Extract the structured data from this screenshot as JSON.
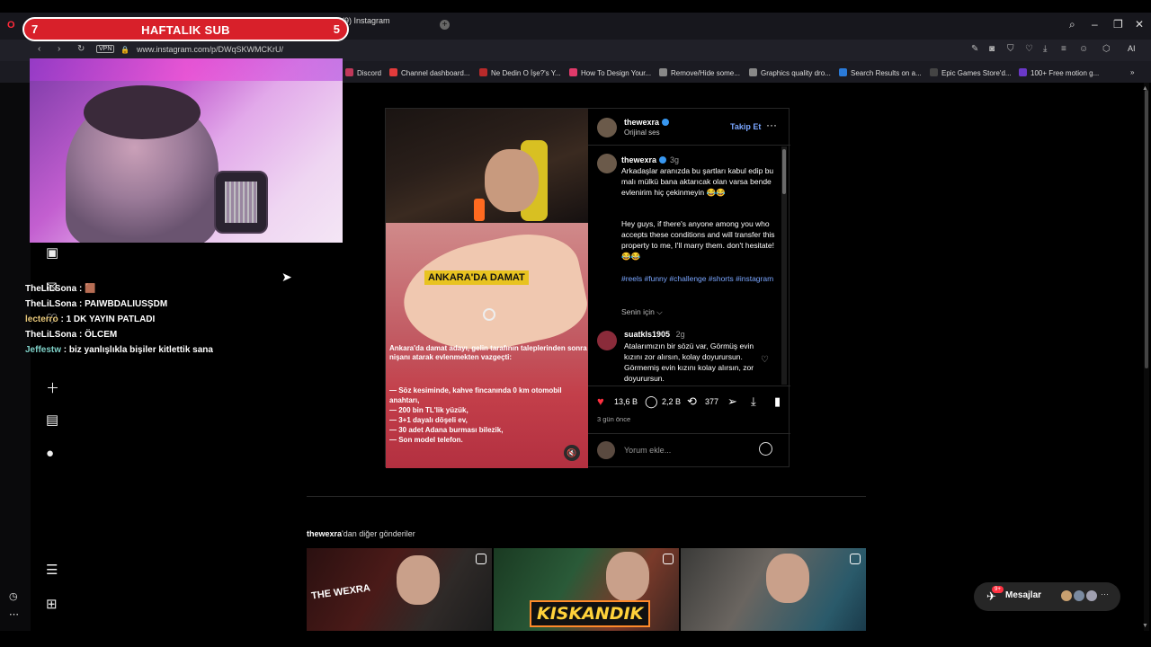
{
  "browser": {
    "tab_title": "(9) Instagram",
    "vpn_label": "VPN",
    "url": "www.instagram.com/p/DWqSKWMCKrU/",
    "ai_label": "AI",
    "bookmarks": [
      {
        "label": "Discord",
        "color": "#c0385a"
      },
      {
        "label": "Channel dashboard...",
        "color": "#e23b3b"
      },
      {
        "label": "Ne Dedin O İşe?'s Y...",
        "color": "#b82a2a"
      },
      {
        "label": "How To Design Your...",
        "color": "#e03a6a"
      },
      {
        "label": "Remove/Hide some...",
        "color": "#888888"
      },
      {
        "label": "Graphics quality dro...",
        "color": "#888888"
      },
      {
        "label": "Search Results on a...",
        "color": "#2a7ad8"
      },
      {
        "label": "Epic Games Store'd...",
        "color": "#444444"
      },
      {
        "label": "100+ Free motion g...",
        "color": "#6a38c8"
      }
    ]
  },
  "overlay": {
    "banner_title": "HAFTALIK SUB",
    "banner_left": "7",
    "banner_right": "5"
  },
  "chat": [
    {
      "user": "TheLiLSona",
      "message": " : 🟫"
    },
    {
      "user": "TheLiLSona",
      "message": " : PAIWBDALIUSŞDM"
    },
    {
      "user": "lecterro",
      "message": " : 1 DK YAYIN PATLADI"
    },
    {
      "user": "TheLiLSona",
      "message": " : ÖLCEM"
    },
    {
      "user": "Jeffestw",
      "message": " : biz yanlışlıkla bişiler kitlettik sana"
    }
  ],
  "post": {
    "username": "thewexra",
    "audio": "Orijinal ses",
    "follow_label": "Takip Et",
    "video_title": "ANKARA'DA DAMAT",
    "video_desc": "Ankara'da damat adayı, gelin tarafının taleplerinden sonra nişanı atarak evlenmekten vazgeçti:",
    "video_list": [
      "— Söz kesiminde, kahve fincanında 0 km otomobil anahtarı,",
      "— 200 bin TL'lik yüzük,",
      "— 3+1 dayalı döşeli ev,",
      "— 30 adet Adana burması bilezik,",
      "— Son model telefon."
    ],
    "caption_user": "thewexra",
    "caption_time": "3g",
    "caption_tr": "Arkadaşlar aranızda bu şartları kabul edip bu malı mülkü bana aktarıcak olan varsa bende evlenirim hiç çekinmeyin 😂😂",
    "caption_en": "Hey guys, if there's anyone among you who accepts these conditions and will transfer this property to me, I'll marry them. don't hesitate! 😂😂",
    "hashtags": "#reels #funny #challenge #shorts #instagram",
    "for_you": "Senin için ⌵",
    "comment_user": "suatkls1905",
    "comment_time": "2g",
    "comment_text": "Atalarımızın bir sözü var, Görmüş evin kızını zor alırsın, kolay doyurursun. Görmemiş evin kızını kolay alırsın, zor doyurursun.",
    "likes": "13,6 B",
    "comments": "2,2 B",
    "reposts": "377",
    "date": "3 gün önce",
    "comment_placeholder": "Yorum ekle..."
  },
  "more_posts": {
    "username": "thewexra",
    "suffix": "'dan diğer gönderiler",
    "thumb1_logo": "THE WEXRA",
    "thumb2_text": "KISKANDIK"
  },
  "messages": {
    "label": "Mesajlar",
    "badge": "9+"
  },
  "colors": {
    "accent_link": "#7aa6ff",
    "like_red": "#ff3040",
    "banner_red": "#d8202a"
  },
  "icons": [
    "back-icon",
    "forward-icon",
    "reload-icon",
    "lock-icon",
    "heart-icon",
    "comment-icon",
    "repost-icon",
    "share-icon",
    "save-icon",
    "emoji-icon",
    "mute-icon",
    "more-icon",
    "reels-icon",
    "menu-icon"
  ]
}
